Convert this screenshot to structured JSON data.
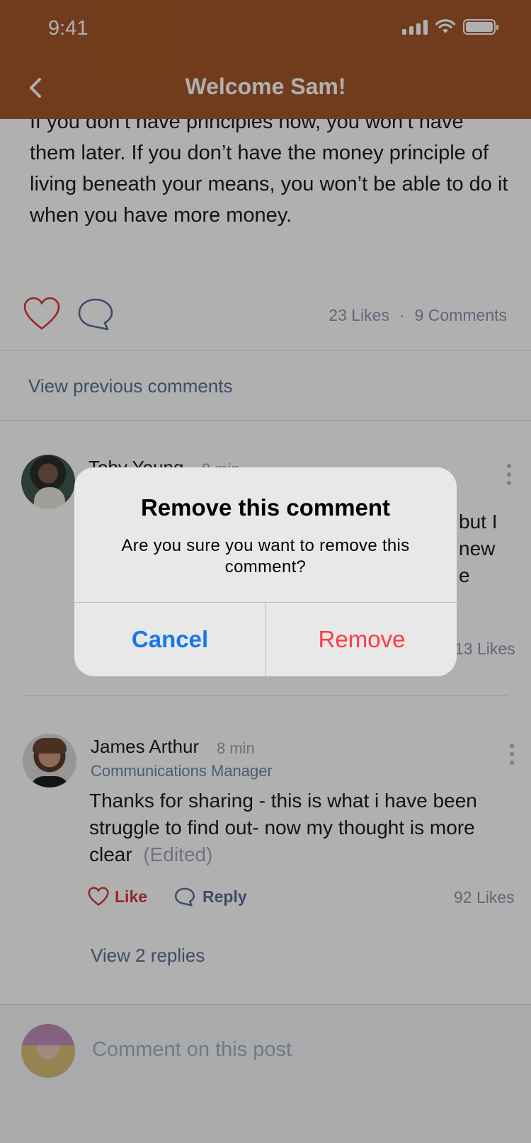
{
  "status_bar": {
    "time": "9:41"
  },
  "header": {
    "title": "Welcome Sam!",
    "back_icon": "chevron-left-icon"
  },
  "post": {
    "text": "If you don’t have principles now, you won’t have them later. If you don’t have the money principle of living beneath your means, you won’t be able to do it when you have more money.",
    "likes": "23 Likes",
    "separator": "·",
    "comments": "9 Comments"
  },
  "view_previous_comments": "View previous comments",
  "comments": [
    {
      "name": "Toby Young",
      "time": "8 min",
      "body_fragments": [
        "but I",
        "new",
        "e"
      ],
      "likes": "13 Likes"
    },
    {
      "name": "James Arthur",
      "time": "8 min",
      "role": "Communications Manager",
      "body": "Thanks for sharing - this is what i have been struggle to find out- now my thought is more clear",
      "edited": "(Edited)",
      "like_label": "Like",
      "reply_label": "Reply",
      "likes": "92 Likes",
      "view_replies": "View 2 replies"
    }
  ],
  "composer": {
    "placeholder": "Comment on this post"
  },
  "dialog": {
    "title": "Remove this comment",
    "message": "Are you sure you want to remove this comment?",
    "cancel_label": "Cancel",
    "remove_label": "Remove"
  },
  "colors": {
    "header": "#a4582a",
    "accent_blue": "#1678e6",
    "destructive_red": "#ff3b45",
    "like_red": "#d43c36",
    "link_blue_gray": "#5a6f96"
  }
}
